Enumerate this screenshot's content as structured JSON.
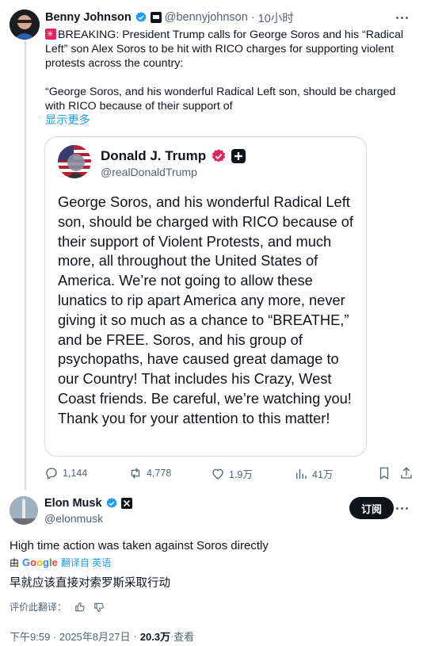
{
  "tweet1": {
    "author_name": "Benny Johnson",
    "author_handle": "@bennyjohnson",
    "separator": "·",
    "time": "10小时",
    "text_line1": "BREAKING: President Trump calls for George Soros and his “Radical Left” son Alex Soros to be hit with RICO charges for supporting violent protests across the country:",
    "text_line2": "“George Soros, and his wonderful Radical Left son, should be charged with RICO because of their support of",
    "show_more": "显示更多",
    "quote": {
      "author_name": "Donald J. Trump",
      "author_handle": "@realDonaldTrump",
      "text": "George Soros, and his wonderful Radical Left son, should be charged with RICO because of their support of Violent Protests, and much more, all throughout the United States of America. We’re not going to allow these lunatics to rip apart America any more, never giving it so much as a chance to “BREATHE,” and be FREE. Soros, and his group of psychopaths, have caused great damage to our Country! That includes his Crazy, West Coast friends. Be careful, we’re watching you! Thank you for your attention to this matter!"
    },
    "actions": {
      "replies": "1,144",
      "reposts": "4,778",
      "likes": "1.9万",
      "views": "41万"
    }
  },
  "tweet2": {
    "author_name": "Elon Musk",
    "author_handle": "@elonmusk",
    "subscribe_label": "订阅",
    "text": "High time action was taken against Soros directly",
    "translate_by": "由",
    "google": "Google",
    "translate_link": "翻译自 英语",
    "translated_text": "早就应该直接对索罗斯采取行动",
    "rate_label": "评价此翻译：",
    "time": "下午9:59 · 2025年8月27日",
    "dot": "·",
    "views_count": "20.3万",
    "views_label": "查看"
  },
  "colors": {
    "accent": "#1d9bf0",
    "text": "#0f1419",
    "muted": "#536471",
    "border": "#cfd9de",
    "trump_badge": "#e0245e"
  },
  "icons": [
    "verified-icon",
    "more-icon",
    "reply-icon",
    "repost-icon",
    "like-icon",
    "views-icon",
    "bookmark-icon",
    "share-icon",
    "thumbs-up-icon",
    "thumbs-down-icon",
    "x-logo-icon",
    "plus-badge-icon"
  ]
}
